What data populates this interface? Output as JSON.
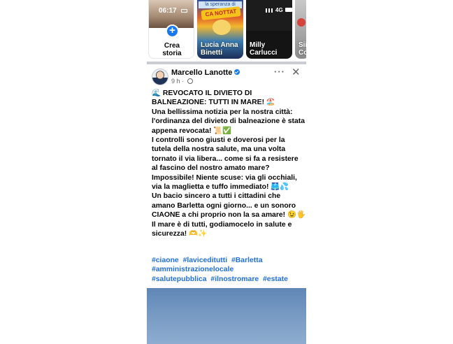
{
  "stories": {
    "create": {
      "label_line1": "Crea",
      "label_line2": "storia",
      "plus": "+",
      "thumb_time": "06:17"
    },
    "items": [
      {
        "name_line1": "Lucia Anna",
        "name_line2": "Binetti",
        "banner_top": "la speranza di",
        "banner_main": "CA NOTTAT"
      },
      {
        "name_line1": "Milly",
        "name_line2": "Carlucci",
        "network": "4G"
      },
      {
        "name_line1": "Sii",
        "name_line2": "Co"
      }
    ]
  },
  "post": {
    "author": "Marcello Lanotte",
    "time": "9 h ·",
    "more_label": "···",
    "close_label": "✕",
    "lines": [
      "🌊 REVOCATO IL DIVIETO DI BALNEAZIONE: TUTTI IN MARE! 🏖️",
      "Una bellissima notizia per la nostra città: l'ordinanza del divieto di balneazione è stata appena revocata! 📜✅",
      "I controlli sono giusti e doverosi per la tutela della nostra salute, ma una volta tornato il via libera... come si fa a resistere al fascino del nostro amato mare? Impossibile! Niente scuse: via gli occhiali, via la maglietta e tuffo immediato! 🩳💦",
      "Un bacio sincero a tutti i cittadini che amano Barletta ogni giorno... e un sonoro CIAONE a chi proprio non la sa amare! 😉🖐️",
      "Il mare è di tutti, godiamocelo in salute e sicurezza! 🫶✨"
    ],
    "hashtags": [
      "#ciaone",
      "#laviceditutti",
      "#Barletta",
      "#amministrazionelocale",
      "#salutepubblica",
      "#ilnostromare",
      "#estate"
    ]
  },
  "colors": {
    "accent": "#1877f2",
    "hashtag": "#216fdb",
    "text": "#050505",
    "muted": "#65676b"
  }
}
